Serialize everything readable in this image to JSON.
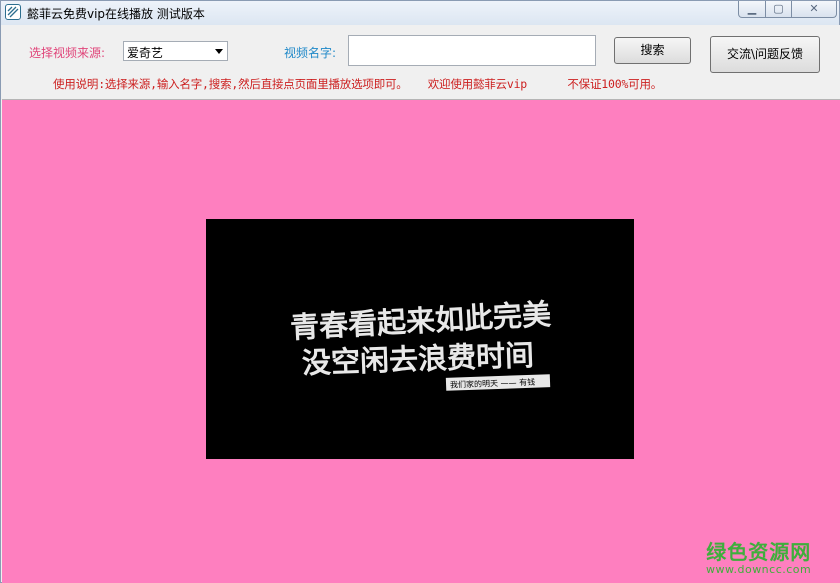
{
  "window": {
    "title": "懿菲云免费vip在线播放  测试版本",
    "icon": "app-logo-icon",
    "controls": {
      "minimize": "minimize-icon",
      "maximize": "maximize-icon",
      "close": "close-icon"
    }
  },
  "toolbar": {
    "source_label": "选择视频来源:",
    "source_value": "爱奇艺",
    "name_label": "视频名字:",
    "name_value": "",
    "search_label": "搜索",
    "feedback_label": "交流\\问题反馈",
    "instructions": "使用说明:选择来源,输入名字,搜索,然后直接点页面里播放选项即可。   欢迎使用懿菲云vip      不保证100%可用。"
  },
  "video": {
    "line1": "青春看起来如此完美",
    "line2": "没空闲去浪费时间",
    "tag": "我们家的明天 —— 有钱"
  },
  "watermark": {
    "main": "绿色资源网",
    "url": "www.downcc.com"
  },
  "colors": {
    "pink_background": "#fe7fbf",
    "source_label": "#e0457a",
    "name_label": "#1e88c8",
    "instructions": "#cc1f1f",
    "watermark": "#3fae3c"
  }
}
